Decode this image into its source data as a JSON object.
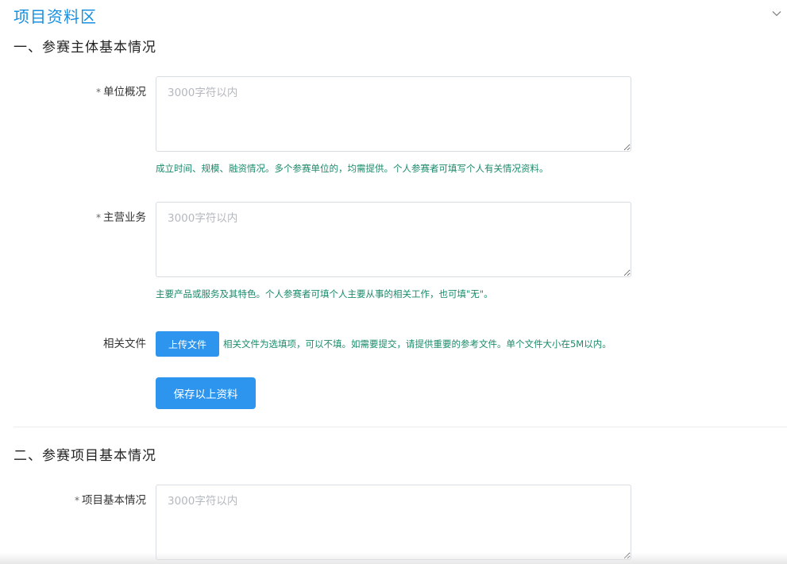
{
  "page": {
    "title": "项目资料区",
    "collapse_icon": "chevron-down-icon"
  },
  "section1": {
    "title": "一、参赛主体基本情况",
    "fields": [
      {
        "required_mark": "*",
        "label": "单位概况",
        "placeholder": "3000字符以内",
        "value": "",
        "hint": "成立时间、规模、融资情况。多个参赛单位的，均需提供。个人参赛者可填写个人有关情况资料。"
      },
      {
        "required_mark": "*",
        "label": "主营业务",
        "placeholder": "3000字符以内",
        "value": "",
        "hint": "主要产品或服务及其特色。个人参赛者可填个人主要从事的相关工作，也可填\"无\"。"
      }
    ],
    "upload": {
      "label": "相关文件",
      "button_label": "上传文件",
      "hint": "相关文件为选填项，可以不填。如需要提交，请提供重要的参考文件。单个文件大小在5M以内。"
    },
    "save_button_label": "保存以上资料"
  },
  "section2": {
    "title": "二、参赛项目基本情况",
    "fields": [
      {
        "required_mark": "*",
        "label": "项目基本情况",
        "placeholder": "3000字符以内",
        "value": ""
      }
    ]
  },
  "colors": {
    "accent": "#2e95ee",
    "title": "#1890e0",
    "hint": "#1a8a6a"
  }
}
